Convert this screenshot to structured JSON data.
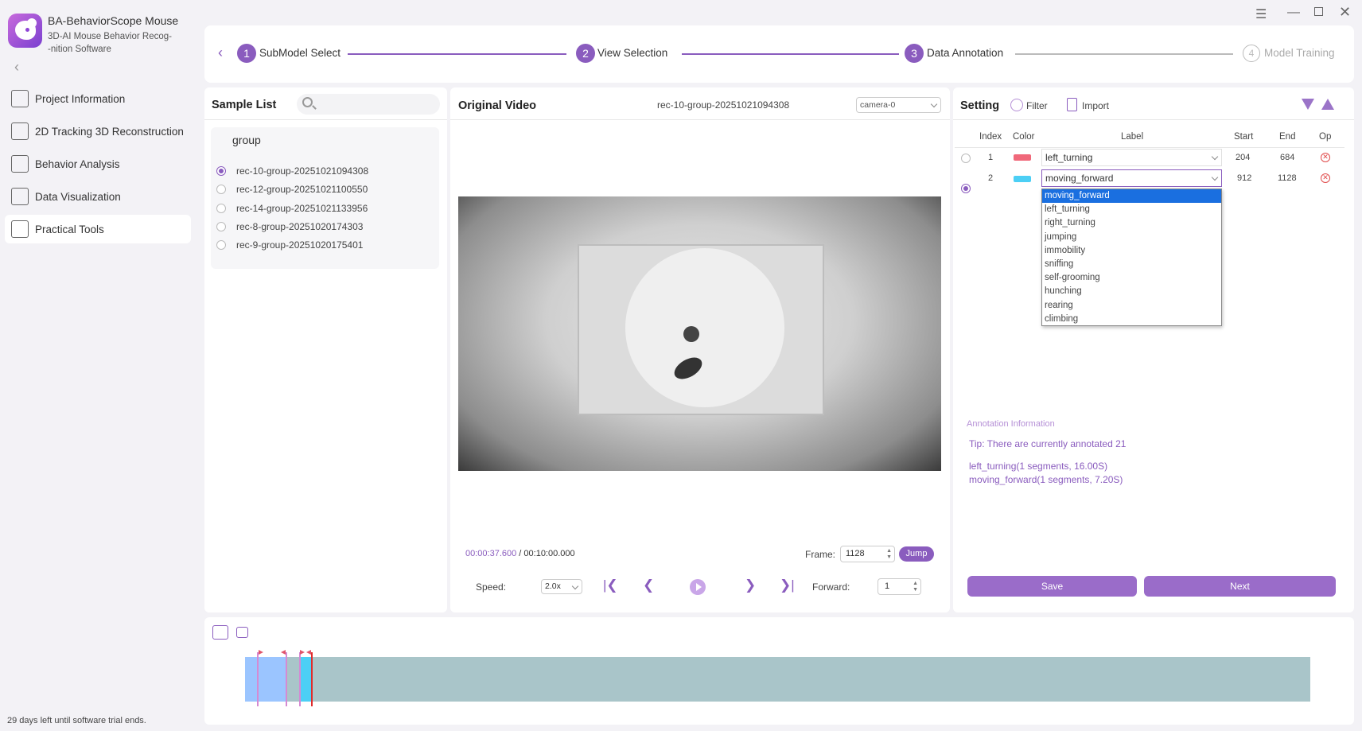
{
  "app": {
    "title": "BA-BehaviorScope Mouse",
    "subtitle_line1": "3D-AI Mouse Behavior Recog-",
    "subtitle_line2": "-nition Software",
    "trial_notice": "29 days left until software trial ends."
  },
  "sidebar": {
    "items": [
      {
        "label": "Project Information",
        "icon": "project-info-icon"
      },
      {
        "label": "2D Tracking 3D Reconstruction",
        "icon": "cube-icon"
      },
      {
        "label": "Behavior Analysis",
        "icon": "analysis-chart-icon"
      },
      {
        "label": "Data Visualization",
        "icon": "checklist-icon"
      },
      {
        "label": "Practical Tools",
        "icon": "tools-icon"
      }
    ],
    "active": "Practical Tools"
  },
  "stepper": {
    "steps": [
      {
        "num": "1",
        "label": "SubModel Select"
      },
      {
        "num": "2",
        "label": "View Selection"
      },
      {
        "num": "3",
        "label": "Data Annotation"
      },
      {
        "num": "4",
        "label": "Model Training"
      }
    ]
  },
  "sample_list": {
    "title": "Sample List",
    "search_placeholder": "",
    "group_label": "group",
    "items": [
      "rec-10-group-20251021094308",
      "rec-12-group-20251021100550",
      "rec-14-group-20251021133956",
      "rec-8-group-20251020174303",
      "rec-9-group-20251020175401"
    ],
    "selected_index": 0
  },
  "video": {
    "title": "Original Video",
    "file_name": "rec-10-group-20251021094308",
    "camera": "camera-0",
    "current_time": "00:00:37.600",
    "separator": " / ",
    "total_time": "00:10:00.000",
    "frame_label": "Frame:",
    "frame_value": "1128",
    "jump_label": "Jump",
    "speed_label": "Speed:",
    "speed_value": "2.0x",
    "forward_label": "Forward:",
    "forward_value": "1"
  },
  "setting": {
    "title": "Setting",
    "filter_label": "Filter",
    "import_label": "Import",
    "columns": [
      "Index",
      "Color",
      "Label",
      "Start",
      "End",
      "Op"
    ],
    "rows": [
      {
        "index": "1",
        "color": "#f0687a",
        "label": "left_turning",
        "start": "204",
        "end": "684",
        "selected": false
      },
      {
        "index": "2",
        "color": "#4ccff5",
        "label": "moving_forward",
        "start": "912",
        "end": "1128",
        "selected": true
      }
    ],
    "dropdown_options": [
      "moving_forward",
      "left_turning",
      "right_turning",
      "jumping",
      "immobility",
      "sniffing",
      "self-grooming",
      "hunching",
      "rearing",
      "climbing"
    ],
    "dropdown_selected": "moving_forward",
    "annotation_title": "Annotation Information",
    "tip": "Tip: There are currently annotated 21",
    "summary": [
      "left_turning(1 segments, 16.00S)",
      "moving_forward(1 segments, 7.20S)"
    ],
    "save_label": "Save",
    "next_label": "Next"
  },
  "timeline": {
    "segments": [
      {
        "label": "left_turning",
        "color": "#9bc5ff"
      },
      {
        "label": "moving_forward",
        "color": "#4ccff5"
      }
    ]
  },
  "colors": {
    "accent": "#8a5cbe",
    "timeline_bg": "#a9c5c9"
  }
}
